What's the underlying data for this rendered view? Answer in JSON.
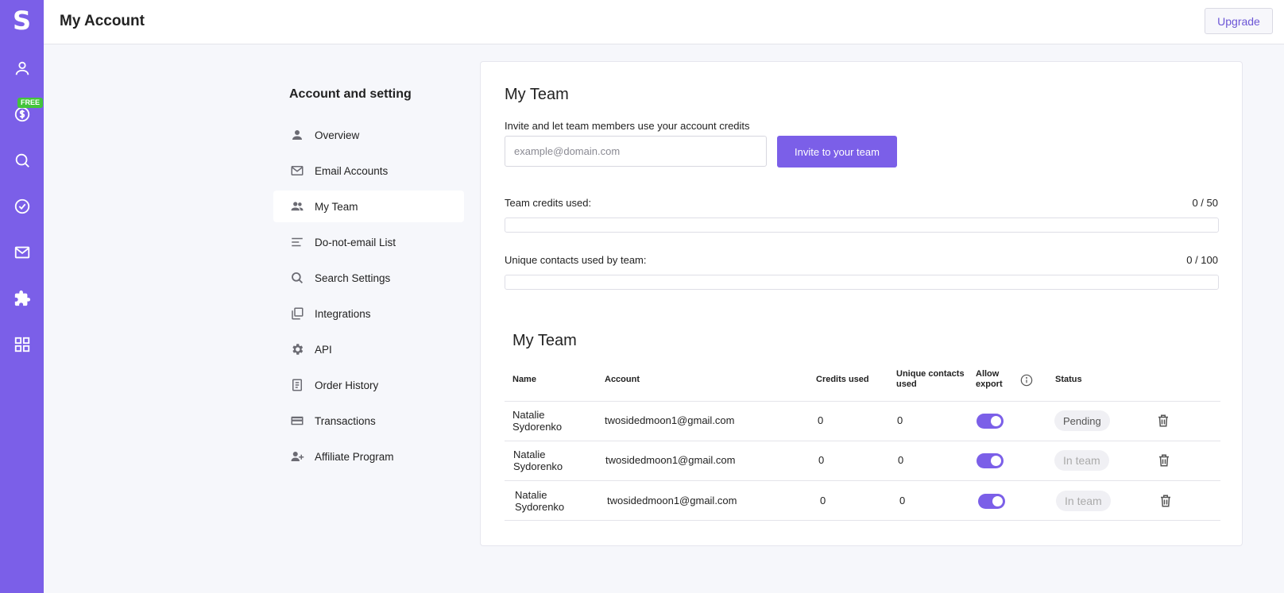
{
  "rail": {
    "logo": "S",
    "free_badge": "FREE",
    "icons": [
      "person-icon",
      "dollar-icon",
      "search-icon",
      "check-circle-icon",
      "mail-icon",
      "puzzle-icon",
      "apps-grid-icon"
    ]
  },
  "header": {
    "title": "My Account",
    "upgrade_label": "Upgrade"
  },
  "menu": {
    "title": "Account and setting",
    "items": [
      {
        "label": "Overview",
        "icon": "person-icon"
      },
      {
        "label": "Email Accounts",
        "icon": "mail-icon"
      },
      {
        "label": "My Team",
        "icon": "team-icon",
        "active": true
      },
      {
        "label": "Do-not-email List",
        "icon": "list-icon"
      },
      {
        "label": "Search Settings",
        "icon": "search-icon"
      },
      {
        "label": "Integrations",
        "icon": "integrations-icon"
      },
      {
        "label": "API",
        "icon": "gear-icon"
      },
      {
        "label": "Order History",
        "icon": "document-icon"
      },
      {
        "label": "Transactions",
        "icon": "credit-card-icon"
      },
      {
        "label": "Affiliate Program",
        "icon": "add-person-icon"
      }
    ]
  },
  "team": {
    "title": "My Team",
    "invite_label": "Invite and let team members use your account credits",
    "email_placeholder": "example@domain.com",
    "email_value": "",
    "invite_button": "Invite to your team",
    "credits_label": "Team credits used:",
    "credits_value": "0 / 50",
    "credits_fraction": 0,
    "contacts_label": "Unique contacts used by team:",
    "contacts_value": "0 / 100",
    "contacts_fraction": 0,
    "table_title": "My Team",
    "columns": {
      "name": "Name",
      "account": "Account",
      "credits": "Credits used",
      "contacts": "Unique contacts used",
      "export": "Allow export",
      "status": "Status"
    },
    "rows": [
      {
        "name": "Natalie Sydorenko",
        "account": "twosidedmoon1@gmail.com",
        "credits": "0",
        "contacts": "0",
        "allow_export": true,
        "status": "Pending"
      },
      {
        "name": "Natalie Sydorenko",
        "account": "twosidedmoon1@gmail.com",
        "credits": "0",
        "contacts": "0",
        "allow_export": true,
        "status": "In team"
      },
      {
        "name": "Natalie Sydorenko",
        "account": "twosidedmoon1@gmail.com",
        "credits": "0",
        "contacts": "0",
        "allow_export": true,
        "status": "In team"
      }
    ]
  },
  "colors": {
    "accent": "#7b5fe8",
    "free_badge": "#43c43b"
  }
}
